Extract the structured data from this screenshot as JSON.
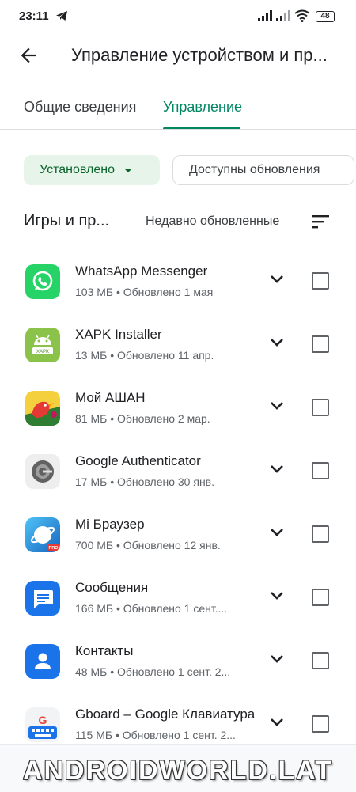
{
  "status_bar": {
    "time": "23:11",
    "battery": "48"
  },
  "header": {
    "title": "Управление устройством и пр..."
  },
  "tabs": [
    {
      "label": "Общие сведения",
      "active": false
    },
    {
      "label": "Управление",
      "active": true
    }
  ],
  "filters": {
    "installed_label": "Установлено",
    "updates_label": "Доступны обновления"
  },
  "section": {
    "title": "Игры и пр...",
    "sort_label": "Недавно обновленные"
  },
  "apps": [
    {
      "name": "WhatsApp Messenger",
      "meta": "103 МБ  •  Обновлено 1 мая"
    },
    {
      "name": "XAPK Installer",
      "meta": "13 МБ  •  Обновлено 11 апр."
    },
    {
      "name": "Мой АШАН",
      "meta": "81 МБ  •  Обновлено 2 мар."
    },
    {
      "name": "Google Authenticator",
      "meta": "17 МБ  •  Обновлено 30 янв."
    },
    {
      "name": "Mi Браузер",
      "meta": "700 МБ  •  Обновлено 12 янв."
    },
    {
      "name": "Сообщения",
      "meta": "166 МБ  •  Обновлено 1 сент...."
    },
    {
      "name": "Контакты",
      "meta": "48 МБ  •  Обновлено 1 сент. 2..."
    },
    {
      "name": "Gboard – Google Клавиатура",
      "meta": "115 МБ  •  Обновлено 1 сент. 2..."
    }
  ],
  "icons": {
    "app_0": "whatsapp-icon",
    "app_1": "xapk-installer-icon",
    "app_2": "auchan-icon",
    "app_3": "authenticator-icon",
    "app_4": "mi-browser-icon",
    "app_5": "messages-icon",
    "app_6": "contacts-icon",
    "app_7": "gboard-icon"
  },
  "colors": {
    "accent": "#01875f",
    "chip_bg": "#e6f4ea"
  },
  "watermark": "ANDROIDWORLD.LAT"
}
